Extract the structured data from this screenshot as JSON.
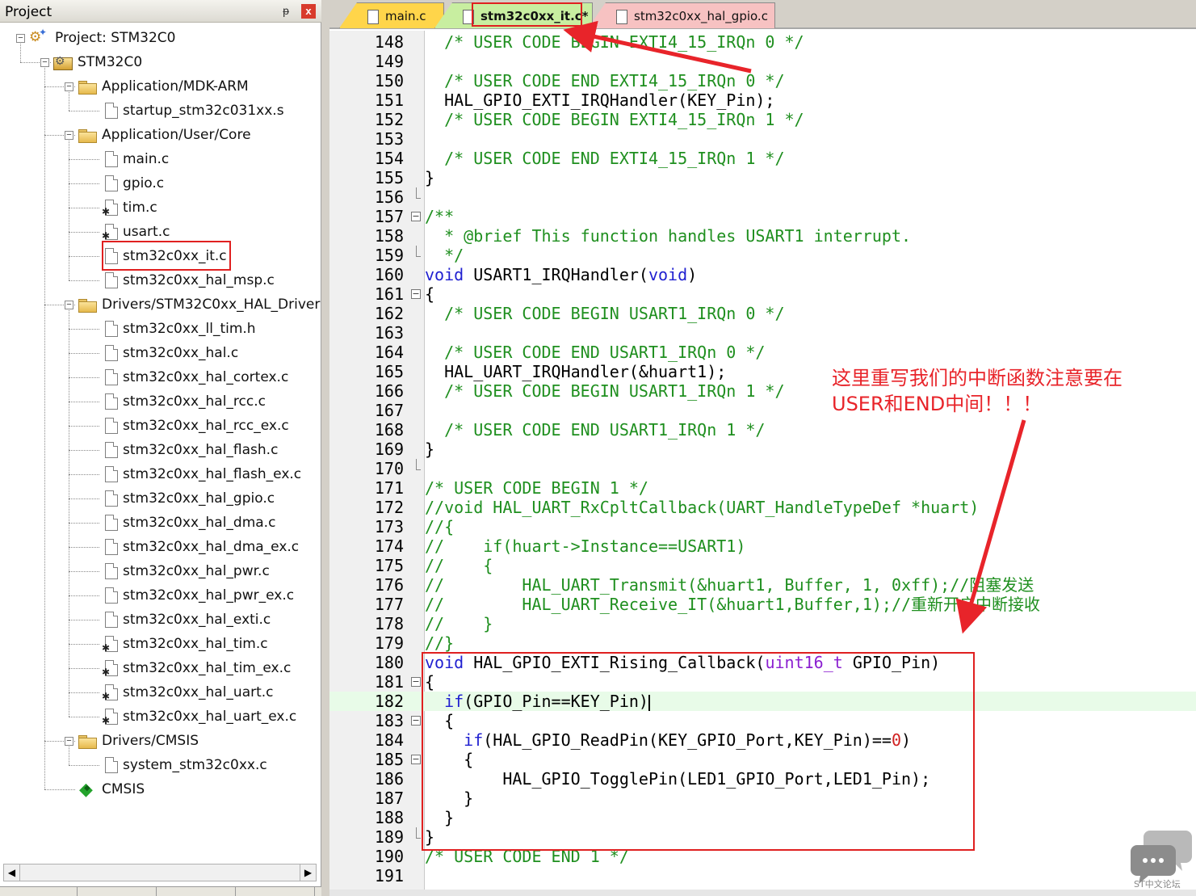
{
  "project_panel": {
    "title": "Project",
    "pin_glyph": "ᵽ",
    "close_glyph": "x",
    "tree": [
      {
        "label": "Project: STM32C0",
        "icon": "project-icon",
        "level": 0,
        "expander": "⊟"
      },
      {
        "label": "STM32C0",
        "icon": "target-icon",
        "level": 1,
        "expander": "⊟"
      },
      {
        "label": "Application/MDK-ARM",
        "icon": "folder-icon",
        "level": 2,
        "expander": "⊟"
      },
      {
        "label": "startup_stm32c031xx.s",
        "icon": "file-icon",
        "level": 3
      },
      {
        "label": "Application/User/Core",
        "icon": "folder-icon",
        "level": 2,
        "expander": "⊟"
      },
      {
        "label": "main.c",
        "icon": "file-icon",
        "level": 3
      },
      {
        "label": "gpio.c",
        "icon": "file-icon",
        "level": 3
      },
      {
        "label": "tim.c",
        "icon": "file-gear-icon",
        "level": 3
      },
      {
        "label": "usart.c",
        "icon": "file-gear-icon",
        "level": 3
      },
      {
        "label": "stm32c0xx_it.c",
        "icon": "file-icon",
        "level": 3
      },
      {
        "label": "stm32c0xx_hal_msp.c",
        "icon": "file-icon",
        "level": 3
      },
      {
        "label": "Drivers/STM32C0xx_HAL_Driver",
        "icon": "folder-icon",
        "level": 2,
        "expander": "⊟"
      },
      {
        "label": "stm32c0xx_ll_tim.h",
        "icon": "file-icon",
        "level": 3
      },
      {
        "label": "stm32c0xx_hal.c",
        "icon": "file-icon",
        "level": 3
      },
      {
        "label": "stm32c0xx_hal_cortex.c",
        "icon": "file-icon",
        "level": 3
      },
      {
        "label": "stm32c0xx_hal_rcc.c",
        "icon": "file-icon",
        "level": 3
      },
      {
        "label": "stm32c0xx_hal_rcc_ex.c",
        "icon": "file-icon",
        "level": 3
      },
      {
        "label": "stm32c0xx_hal_flash.c",
        "icon": "file-icon",
        "level": 3
      },
      {
        "label": "stm32c0xx_hal_flash_ex.c",
        "icon": "file-icon",
        "level": 3
      },
      {
        "label": "stm32c0xx_hal_gpio.c",
        "icon": "file-icon",
        "level": 3
      },
      {
        "label": "stm32c0xx_hal_dma.c",
        "icon": "file-icon",
        "level": 3
      },
      {
        "label": "stm32c0xx_hal_dma_ex.c",
        "icon": "file-icon",
        "level": 3
      },
      {
        "label": "stm32c0xx_hal_pwr.c",
        "icon": "file-icon",
        "level": 3
      },
      {
        "label": "stm32c0xx_hal_pwr_ex.c",
        "icon": "file-icon",
        "level": 3
      },
      {
        "label": "stm32c0xx_hal_exti.c",
        "icon": "file-icon",
        "level": 3
      },
      {
        "label": "stm32c0xx_hal_tim.c",
        "icon": "file-gear-icon",
        "level": 3
      },
      {
        "label": "stm32c0xx_hal_tim_ex.c",
        "icon": "file-gear-icon",
        "level": 3
      },
      {
        "label": "stm32c0xx_hal_uart.c",
        "icon": "file-gear-icon",
        "level": 3
      },
      {
        "label": "stm32c0xx_hal_uart_ex.c",
        "icon": "file-gear-icon",
        "level": 3
      },
      {
        "label": "Drivers/CMSIS",
        "icon": "folder-icon",
        "level": 2,
        "expander": "⊟"
      },
      {
        "label": "system_stm32c0xx.c",
        "icon": "file-icon",
        "level": 3
      },
      {
        "label": "CMSIS",
        "icon": "cmsis-icon",
        "level": 2
      }
    ],
    "scroll_left": "◀",
    "scroll_right": "▶"
  },
  "editor": {
    "tabs": [
      {
        "label": "main.c",
        "color": "#ffd54a"
      },
      {
        "label": "stm32c0xx_it.c*",
        "color": "#c8eea0",
        "active": true
      },
      {
        "label": "stm32c0xx_hal_gpio.c",
        "color": "#f7c2c2"
      }
    ],
    "lines": [
      {
        "n": "148",
        "fold": "",
        "segs": [
          [
            "cm",
            "  /* USER CODE BEGIN EXTI4_15_IRQn 0 */"
          ]
        ]
      },
      {
        "n": "149",
        "fold": "",
        "segs": []
      },
      {
        "n": "150",
        "fold": "",
        "segs": [
          [
            "cm",
            "  /* USER CODE END EXTI4_15_IRQn 0 */"
          ]
        ]
      },
      {
        "n": "151",
        "fold": "",
        "segs": [
          [
            "",
            "  HAL_GPIO_EXTI_IRQHandler(KEY_Pin);"
          ]
        ]
      },
      {
        "n": "152",
        "fold": "",
        "segs": [
          [
            "cm",
            "  /* USER CODE BEGIN EXTI4_15_IRQn 1 */"
          ]
        ]
      },
      {
        "n": "153",
        "fold": "",
        "segs": []
      },
      {
        "n": "154",
        "fold": "",
        "segs": [
          [
            "cm",
            "  /* USER CODE END EXTI4_15_IRQn 1 */"
          ]
        ]
      },
      {
        "n": "155",
        "fold": "",
        "segs": [
          [
            "",
            "}"
          ]
        ]
      },
      {
        "n": "156",
        "fold": "end",
        "segs": []
      },
      {
        "n": "157",
        "fold": "⊟",
        "segs": [
          [
            "cm",
            "/**"
          ]
        ]
      },
      {
        "n": "158",
        "fold": "",
        "segs": [
          [
            "cm",
            "  * @brief This function handles USART1 interrupt."
          ]
        ]
      },
      {
        "n": "159",
        "fold": "end",
        "segs": [
          [
            "cm",
            "  */"
          ]
        ]
      },
      {
        "n": "160",
        "fold": "",
        "segs": [
          [
            "kw",
            "void"
          ],
          [
            "",
            " USART1_IRQHandler("
          ],
          [
            "kw",
            "void"
          ],
          [
            "",
            ")"
          ]
        ]
      },
      {
        "n": "161",
        "fold": "⊟",
        "segs": [
          [
            "",
            "{"
          ]
        ]
      },
      {
        "n": "162",
        "fold": "",
        "segs": [
          [
            "cm",
            "  /* USER CODE BEGIN USART1_IRQn 0 */"
          ]
        ]
      },
      {
        "n": "163",
        "fold": "",
        "segs": []
      },
      {
        "n": "164",
        "fold": "",
        "segs": [
          [
            "cm",
            "  /* USER CODE END USART1_IRQn 0 */"
          ]
        ]
      },
      {
        "n": "165",
        "fold": "",
        "segs": [
          [
            "",
            "  HAL_UART_IRQHandler(&huart1);"
          ]
        ]
      },
      {
        "n": "166",
        "fold": "",
        "segs": [
          [
            "cm",
            "  /* USER CODE BEGIN USART1_IRQn 1 */"
          ]
        ]
      },
      {
        "n": "167",
        "fold": "",
        "segs": []
      },
      {
        "n": "168",
        "fold": "",
        "segs": [
          [
            "cm",
            "  /* USER CODE END USART1_IRQn 1 */"
          ]
        ]
      },
      {
        "n": "169",
        "fold": "",
        "segs": [
          [
            "",
            "}"
          ]
        ]
      },
      {
        "n": "170",
        "fold": "end",
        "segs": []
      },
      {
        "n": "171",
        "fold": "",
        "segs": [
          [
            "cm",
            "/* USER CODE BEGIN 1 */"
          ]
        ]
      },
      {
        "n": "172",
        "fold": "",
        "segs": [
          [
            "cm",
            "//void HAL_UART_RxCpltCallback(UART_HandleTypeDef *huart)"
          ]
        ]
      },
      {
        "n": "173",
        "fold": "",
        "segs": [
          [
            "cm",
            "//{"
          ]
        ]
      },
      {
        "n": "174",
        "fold": "",
        "segs": [
          [
            "cm",
            "//    if(huart->Instance==USART1)"
          ]
        ]
      },
      {
        "n": "175",
        "fold": "",
        "segs": [
          [
            "cm",
            "//    {"
          ]
        ]
      },
      {
        "n": "176",
        "fold": "",
        "segs": [
          [
            "cm",
            "//        HAL_UART_Transmit(&huart1, Buffer, 1, 0xff);//阻塞发送"
          ]
        ]
      },
      {
        "n": "177",
        "fold": "",
        "segs": [
          [
            "cm",
            "//        HAL_UART_Receive_IT(&huart1,Buffer,1);//重新开启中断接收"
          ]
        ]
      },
      {
        "n": "178",
        "fold": "",
        "segs": [
          [
            "cm",
            "//    }"
          ]
        ]
      },
      {
        "n": "179",
        "fold": "",
        "segs": [
          [
            "cm",
            "//}"
          ]
        ]
      },
      {
        "n": "180",
        "fold": "",
        "segs": [
          [
            "kw",
            "void"
          ],
          [
            "",
            " HAL_GPIO_EXTI_Rising_Callback("
          ],
          [
            "ty",
            "uint16_t"
          ],
          [
            "",
            " GPIO_Pin)"
          ]
        ]
      },
      {
        "n": "181",
        "fold": "⊟",
        "segs": [
          [
            "",
            "{"
          ]
        ]
      },
      {
        "n": "182",
        "fold": "",
        "current": true,
        "segs": [
          [
            "kw",
            "  if"
          ],
          [
            "",
            "(GPIO_Pin==KEY_Pin)"
          ]
        ]
      },
      {
        "n": "183",
        "fold": "⊟",
        "segs": [
          [
            "",
            "  {"
          ]
        ]
      },
      {
        "n": "184",
        "fold": "",
        "segs": [
          [
            "kw",
            "    if"
          ],
          [
            "",
            "(HAL_GPIO_ReadPin(KEY_GPIO_Port,KEY_Pin)=="
          ],
          [
            "num",
            "0"
          ],
          [
            "",
            ")"
          ]
        ]
      },
      {
        "n": "185",
        "fold": "⊟",
        "segs": [
          [
            "",
            "    {"
          ]
        ]
      },
      {
        "n": "186",
        "fold": "",
        "segs": [
          [
            "",
            "        HAL_GPIO_TogglePin(LED1_GPIO_Port,LED1_Pin);"
          ]
        ]
      },
      {
        "n": "187",
        "fold": "",
        "segs": [
          [
            "",
            "    }"
          ]
        ]
      },
      {
        "n": "188",
        "fold": "",
        "segs": [
          [
            "",
            "  }"
          ]
        ]
      },
      {
        "n": "189",
        "fold": "end",
        "segs": [
          [
            "",
            "}"
          ]
        ]
      },
      {
        "n": "190",
        "fold": "",
        "segs": [
          [
            "cm",
            "/* USER CODE END 1 */"
          ]
        ]
      },
      {
        "n": "191",
        "fold": "",
        "segs": []
      }
    ]
  },
  "annotation": {
    "text_line1": "这里重写我们的中断函数注意要在",
    "text_line2": "USER和END中间！！！",
    "color": "#e8242a"
  },
  "watermark": {
    "text": "ST中文论坛"
  }
}
